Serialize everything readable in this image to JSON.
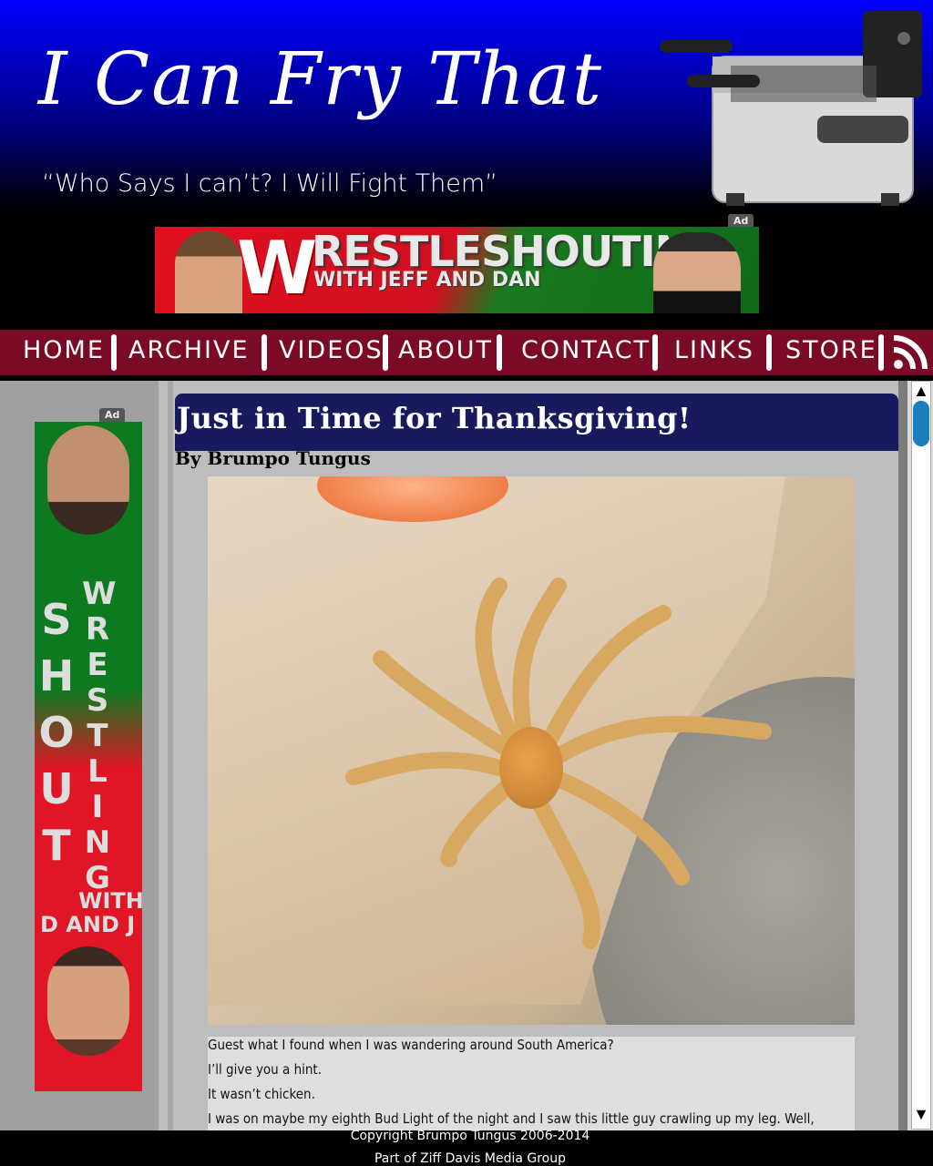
{
  "header": {
    "site_title": "I Can Fry That",
    "tagline": "“Who Says I can’t? I Will Fight Them”",
    "fryer_icon": "deep-fryer-image"
  },
  "top_ad": {
    "badge": "Ad",
    "logo": "W",
    "headline": "RESTLESHOUTING",
    "subline": "WITH JEFF AND DAN"
  },
  "nav": {
    "items": [
      "HOME",
      "ARCHIVE",
      "VIDEOS",
      "ABOUT",
      "CONTACT",
      "LINKS",
      "STORE"
    ],
    "rss_icon": "rss-icon",
    "color": "#7a0a26"
  },
  "side_ad": {
    "badge": "Ad",
    "word1": "SHOUT",
    "word2": "WRESTLING",
    "word3": "WITH",
    "word4": "D AND J"
  },
  "post": {
    "title": "Just in Time for Thanksgiving!",
    "byline": "By Brumpo Tungus",
    "image": "fried-spider-photo",
    "paragraphs": [
      "Guest what I found when I was wandering around South America?",
      "I’ll give you a hint.",
      "It wasn’t chicken.",
      "I was on maybe my eighth Bud Light of the night and I saw this little guy crawling up my leg. Well,"
    ]
  },
  "scrollbar": {
    "up": "▲",
    "down": "▼"
  },
  "footer": {
    "copyright": "Copyright Brumpo Tungus 2006-2014",
    "network": "Part of Ziff Davis Media Group"
  },
  "colors": {
    "title_bar": "#191a5e",
    "header_blue": "#0000ff",
    "scroll_thumb": "#1a7fbf"
  }
}
